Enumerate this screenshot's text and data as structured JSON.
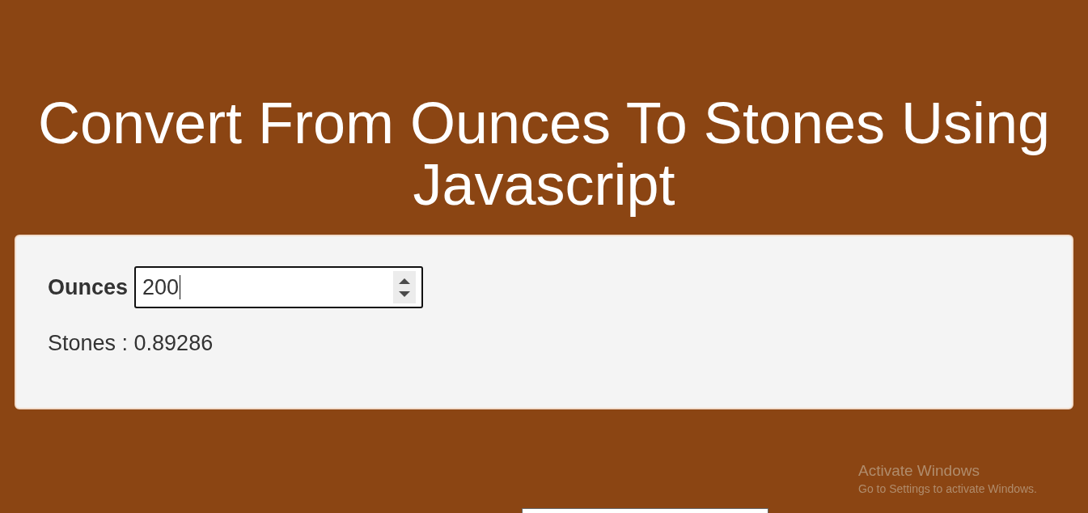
{
  "page": {
    "title": "Convert From Ounces To Stones Using Javascript"
  },
  "converter": {
    "input_label": "Ounces",
    "input": {
      "value": "200",
      "focused": true
    },
    "result": "Stones : 0.89286"
  },
  "os_overlay": {
    "heading": "Activate Windows",
    "subtext": "Go to Settings to activate Windows."
  }
}
